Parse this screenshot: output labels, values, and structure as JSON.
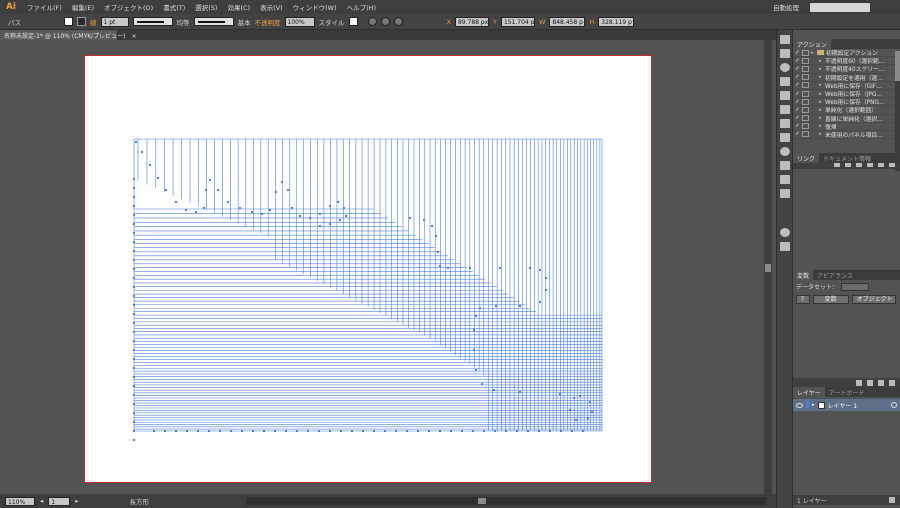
{
  "app": {
    "logo": "Ai"
  },
  "menubar": {
    "items": [
      "ファイル(F)",
      "編集(E)",
      "オブジェクト(O)",
      "書式(T)",
      "選択(S)",
      "効果(C)",
      "表示(V)",
      "ウィンドウ(W)",
      "ヘルプ(H)"
    ],
    "workspace": "自動処理"
  },
  "controlbar": {
    "object_type": "パス",
    "stroke_label": "線",
    "stroke_weight": "1 pt",
    "profile": "均等",
    "brush": "基本",
    "opacity_label": "不透明度",
    "opacity": "100%",
    "style_label": "スタイル",
    "x_label": "X",
    "x_value": "89.788 px",
    "y_label": "Y",
    "y_value": "151.704 p",
    "w_label": "W",
    "w_value": "848.458 p",
    "h_label": "H",
    "h_value": "328.119 p"
  },
  "document": {
    "tab_title": "名称未設定-1* @ 110% (CMYK/プレビュー)",
    "tab_close": "×"
  },
  "artwork": {
    "path_color": "#4a7fe0"
  },
  "statusbar": {
    "zoom": "110%",
    "artboard": "1",
    "tool": "長方形"
  },
  "actions_panel": {
    "tabs": [
      "アクション"
    ],
    "rows": [
      {
        "label": "初期設定アクション",
        "type": "set"
      },
      {
        "label": "不透明度60（選択範…",
        "type": "action"
      },
      {
        "label": "不透明度40スクリー…",
        "type": "action"
      },
      {
        "label": "初期設定を適用（選…",
        "type": "action"
      },
      {
        "label": "Web用に保存（GIF…",
        "type": "action"
      },
      {
        "label": "Web用に保存（JPG…",
        "type": "action"
      },
      {
        "label": "Web用に保存（PNG…",
        "type": "action"
      },
      {
        "label": "単純化（選択範囲）",
        "type": "action"
      },
      {
        "label": "直線に単純化（選択…",
        "type": "action"
      },
      {
        "label": "復帰",
        "type": "action"
      },
      {
        "label": "未使用のパネル項目…",
        "type": "action"
      }
    ]
  },
  "links_panel": {
    "tabs": [
      "リンク",
      "ドキュメント情報"
    ]
  },
  "attributes_panel": {
    "tabs": [
      "変数",
      "アピアランス"
    ],
    "dataset_label": "データセット：",
    "button_variable": "変数",
    "button_object": "オブジェクト"
  },
  "layers_panel": {
    "tabs": [
      "レイヤー",
      "アートボード"
    ],
    "layer_name": "レイヤー 1",
    "footer": "1 レイヤー"
  }
}
